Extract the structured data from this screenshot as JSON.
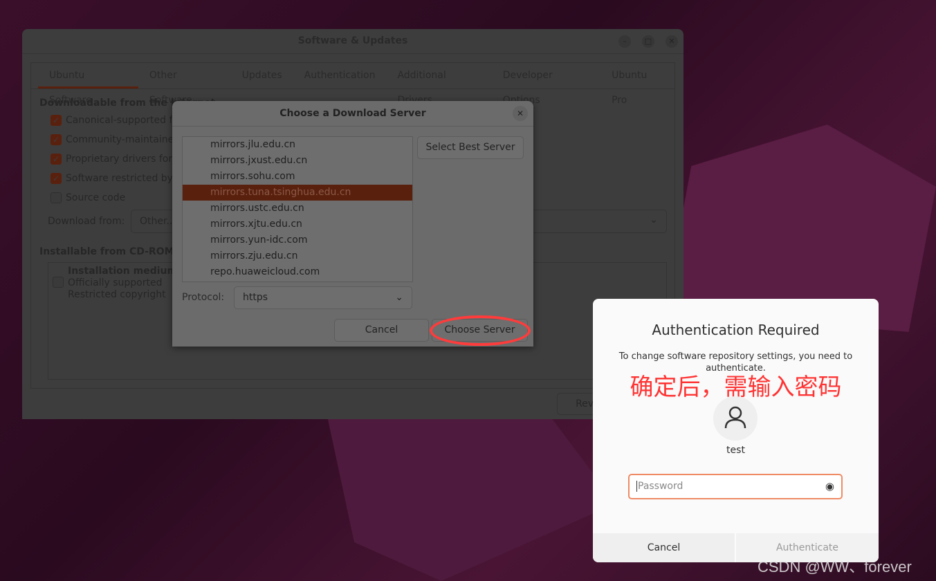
{
  "main_window": {
    "title": "Software & Updates",
    "tabs": [
      "Ubuntu Software",
      "Other Software",
      "Updates",
      "Authentication",
      "Additional Drivers",
      "Developer Options",
      "Ubuntu Pro"
    ],
    "section_internet": "Downloadable from the Internet",
    "checkboxes": [
      {
        "label": "Canonical-supported free and open-source software (main)",
        "checked": true
      },
      {
        "label": "Community-maintained free and open-source software (universe)",
        "checked": true
      },
      {
        "label": "Proprietary drivers for devices (restricted)",
        "checked": true
      },
      {
        "label": "Software restricted by copyright or legal issues (multiverse)",
        "checked": true
      },
      {
        "label": "Source code",
        "checked": false
      }
    ],
    "download_from_label": "Download from:",
    "download_from_value": "Other...",
    "section_cdrom": "Installable from CD-ROM/DVD",
    "cdrom_item": {
      "title": "Installation medium with Ubuntu",
      "line1": "Officially supported",
      "line2": "Restricted copyright"
    },
    "revert_label": "Revert"
  },
  "chooser": {
    "title": "Choose a Download Server",
    "servers": [
      "mirrors.jlu.edu.cn",
      "mirrors.jxust.edu.cn",
      "mirrors.sohu.com",
      "mirrors.tuna.tsinghua.edu.cn",
      "mirrors.ustc.edu.cn",
      "mirrors.xjtu.edu.cn",
      "mirrors.yun-idc.com",
      "mirrors.zju.edu.cn",
      "repo.huaweicloud.com"
    ],
    "selected": "mirrors.tuna.tsinghua.edu.cn",
    "select_best_label": "Select Best Server",
    "protocol_label": "Protocol:",
    "protocol_value": "https",
    "cancel_label": "Cancel",
    "choose_label": "Choose Server"
  },
  "auth": {
    "title": "Authentication Required",
    "message": "To change software repository settings, you need to authenticate.",
    "annotation": "确定后，需输入密码",
    "username": "test",
    "password_placeholder": "Password",
    "cancel_label": "Cancel",
    "authenticate_label": "Authenticate"
  },
  "watermark": "CSDN @WW、forever",
  "colors": {
    "accent": "#e95420",
    "annotation": "#ff3333"
  }
}
